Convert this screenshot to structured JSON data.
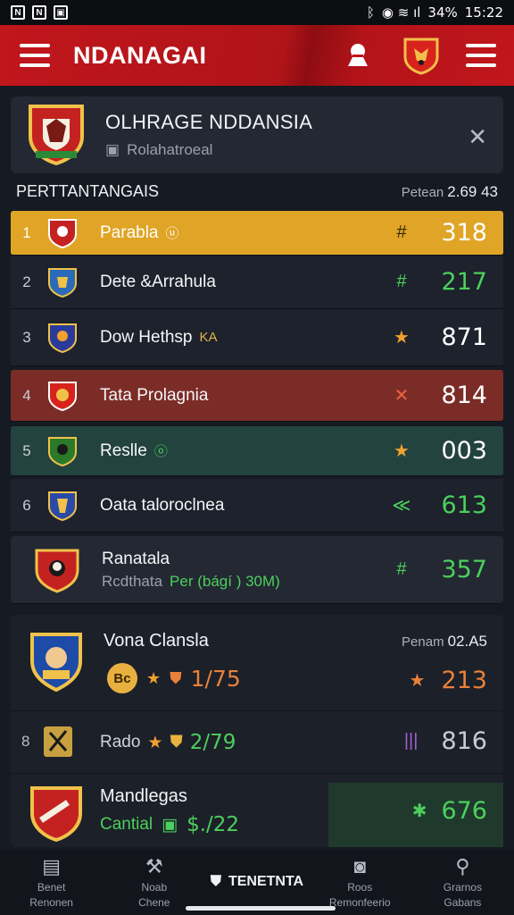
{
  "status_bar": {
    "left_icons": [
      "N",
      "N",
      "image-icon"
    ],
    "battery": "34%",
    "time": "15:22"
  },
  "topbar": {
    "title": "NDANAGAI"
  },
  "header_card": {
    "title": "OLHRAGE NDDANSIA",
    "subtitle": "Rolahatroeal"
  },
  "section": {
    "label": "PERTTANTANGAIS",
    "points_label": "Petean",
    "points_value": "2.69 43"
  },
  "rows": [
    {
      "rank": "1",
      "name": "Parabla",
      "tag": "ⓤ",
      "icon": "#",
      "value": "318",
      "icon_color": "#ffffff",
      "value_color": "#ffffff"
    },
    {
      "rank": "2",
      "name": "Dete &Arrahula",
      "tag": "",
      "icon": "#",
      "value": "217",
      "icon_color": "#4ccf5c",
      "value_color": "#4ccf5c"
    },
    {
      "rank": "3",
      "name": "Dow Hethsp",
      "tag": "KA",
      "icon": "★",
      "value": "871",
      "icon_color": "#f0a030",
      "value_color": "#ffffff"
    },
    {
      "rank": "4",
      "name": "Tata Prolagnia",
      "tag": "",
      "icon": "✕",
      "value": "814",
      "icon_color": "#f06040",
      "value_color": "#ffffff"
    },
    {
      "rank": "5",
      "name": "Reslle",
      "tag": "ⓞ",
      "icon": "★",
      "value": "003",
      "icon_color": "#f0a030",
      "value_color": "#ffffff"
    },
    {
      "rank": "6",
      "name": "Oata taloroclnea",
      "tag": "",
      "icon": "≪",
      "value": "613",
      "icon_color": "#4ccf5c",
      "value_color": "#4ccf5c"
    }
  ],
  "row7": {
    "name": "Ranatala",
    "sub_name": "Rcdthata",
    "sub_note": "Per (bágí ) 30M)",
    "icon": "#",
    "value": "357"
  },
  "card1": {
    "name": "Vona Clansla",
    "points_label": "Penam",
    "points_value": "02.A5",
    "coin": "Bc",
    "score": "1/75",
    "value": "213"
  },
  "card2": {
    "rank": "8",
    "name": "Rado",
    "score": "2/79",
    "value": "816"
  },
  "card3": {
    "name": "Mandlegas",
    "sub_name": "Cantial",
    "score": "$./22",
    "value": "676"
  },
  "bottom_nav": [
    {
      "label1": "Benet",
      "label2": "Renonen"
    },
    {
      "label1": "Noab",
      "label2": "Chene"
    },
    {
      "label1": "TENETNTA",
      "label2": ""
    },
    {
      "label1": "Roos",
      "label2": "Remonfeerio"
    },
    {
      "label1": "Grarnos",
      "label2": "Gabans"
    }
  ],
  "colors": {
    "brand_red": "#c0161c",
    "gold_row": "#e0a526",
    "green": "#4ccf5c",
    "orange": "#e8813a"
  }
}
